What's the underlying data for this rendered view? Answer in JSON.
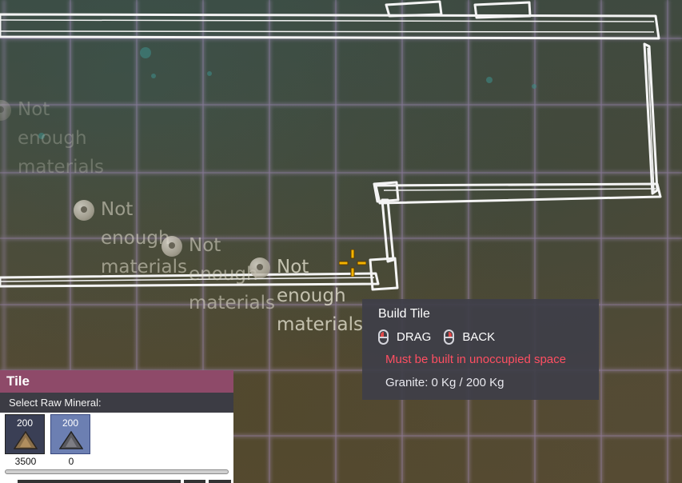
{
  "world": {
    "placement_messages": [
      "Not enough materials",
      "Not enough materials",
      "Not enough materials",
      "Not enough materials"
    ]
  },
  "tooltip": {
    "title": "Build Tile",
    "drag_label": "DRAG",
    "back_label": "BACK",
    "warning": "Must be built in unoccupied space",
    "cost": "Granite: 0 Kg / 200 Kg",
    "warning_color": "#ff4f62"
  },
  "build_panel": {
    "title": "Tile",
    "subtitle": "Select Raw Mineral:",
    "header_color": "#8e4a69",
    "materials": [
      {
        "amount": "200",
        "stock": "3500",
        "icon": "sandstone-icon",
        "selected": false
      },
      {
        "amount": "200",
        "stock": "0",
        "icon": "granite-icon",
        "selected": true
      }
    ]
  }
}
